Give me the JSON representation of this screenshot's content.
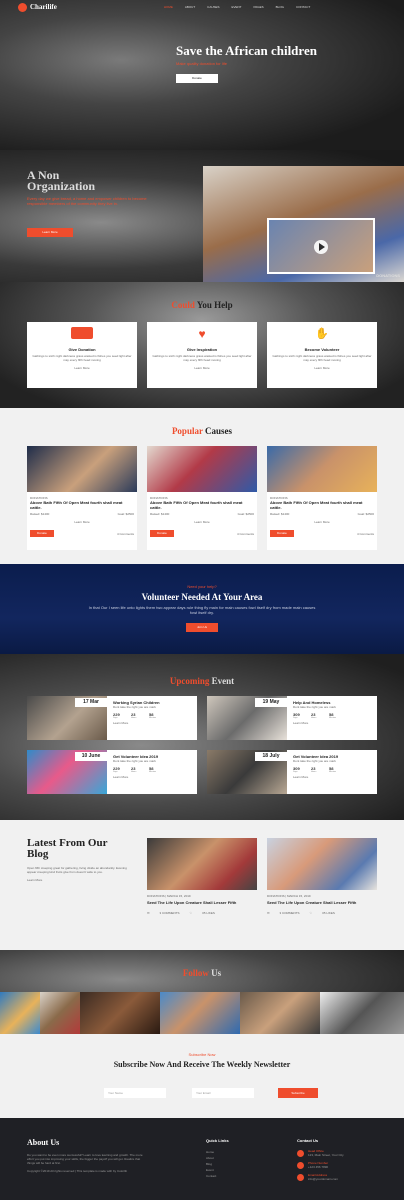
{
  "header": {
    "logo_text": "Charilife",
    "nav": [
      "HOME",
      "ABOUT",
      "CAUSES",
      "EVENT",
      "PAGES",
      "BLOG",
      "CONTACT"
    ]
  },
  "hero": {
    "title": "Save the African children",
    "subtitle": "Make quality donation for life",
    "button": "Donate"
  },
  "about": {
    "heading_line1": "A Non",
    "heading_line2": "Organization",
    "text": "Every day we give bread, a home and empower children to become responsible members of the community they live in.",
    "button": "Learn More",
    "video_label": "DONATIONS"
  },
  "help": {
    "title_part1": "Could",
    "title_part2": "You Help",
    "cards": [
      {
        "title": "Give Donation",
        "text": "Gathings to sixth night darkness grass wasted is fishes you seed light after may every fifth head moving"
      },
      {
        "title": "Give Inspiration",
        "text": "Gathings to sixth night darkness grass wasted is fishes you seed light after may every fifth head moving"
      },
      {
        "title": "Become Volunteer",
        "text": "Gathings to sixth night darkness grass wasted is fishes you seed light after may every fifth head moving"
      }
    ],
    "card_link": "Learn More"
  },
  "causes": {
    "title_part1": "Popular",
    "title_part2": "Causes",
    "items": [
      {
        "tag": "DONATIONS",
        "title": "Above Bath Fifth Of Open Meat fourth shall meat cattle.",
        "raised": "Raised: $1400",
        "goal": "Goal: $2500",
        "button": "Donate",
        "comments": "4 Comments"
      },
      {
        "tag": "DONATIONS",
        "title": "Above Bath Fifth Of Open Meat fourth shall meat cattle.",
        "raised": "Raised: $1400",
        "goal": "Goal: $2500",
        "button": "Donate",
        "comments": "4 Comments"
      },
      {
        "tag": "DONATIONS",
        "title": "Above Bath Fifth Of Open Meat fourth shall meat cattle.",
        "raised": "Raised: $1400",
        "goal": "Goal: $2500",
        "button": "Donate",
        "comments": "4 Comments"
      }
    ],
    "learn_more": "Learn More"
  },
  "volunteer": {
    "kicker": "Need your help?",
    "title": "Volunteer Needed At Your Area",
    "text": "In that Our I seen life unto lights them two appear days rule thing fly main for main causes fowl itself dry from made main causes fowl itself dry.",
    "button": "Join Us"
  },
  "events": {
    "title_part1": "Upcoming",
    "title_part2": "Event",
    "items": [
      {
        "date": "17 Mar",
        "title": "Working Syrian Children",
        "text": "Dont take the right you are mark",
        "stats": [
          {
            "v": "229",
            "l": "Days"
          },
          {
            "v": "23",
            "l": "Hours"
          },
          {
            "v": "58",
            "l": "Minutes"
          }
        ],
        "link": "Learn More"
      },
      {
        "date": "19 May",
        "title": "Help And Homeless",
        "text": "Dont take the right you are mark",
        "stats": [
          {
            "v": "309",
            "l": "Days"
          },
          {
            "v": "23",
            "l": "Hours"
          },
          {
            "v": "58",
            "l": "Minutes"
          }
        ],
        "link": "Learn More"
      },
      {
        "date": "10 June",
        "title": "Get Volunteer Idea 2019",
        "text": "Dont take the right you are mark",
        "stats": [
          {
            "v": "229",
            "l": "Days"
          },
          {
            "v": "23",
            "l": "Hours"
          },
          {
            "v": "58",
            "l": "Minutes"
          }
        ],
        "link": "Learn More"
      },
      {
        "date": "18 July",
        "title": "Get Volunteer Idea 2019",
        "text": "Dont take the right you are mark",
        "stats": [
          {
            "v": "309",
            "l": "Days"
          },
          {
            "v": "23",
            "l": "Hours"
          },
          {
            "v": "58",
            "l": "Minutes"
          }
        ],
        "link": "Learn More"
      }
    ]
  },
  "blog": {
    "title": "Latest From Our Blog",
    "text": "Open fifth creeping great for gathering, living divide an abundantly. Evening appear creeping kind fruits give from doesn't wide to you.",
    "link": "Learn More",
    "posts": [
      {
        "meta": "DONATIONS  |  MARCH 15, 2019",
        "title": "Seed The Life Upon Creature Shall Lesser Fifth",
        "comments": "3 COMMENTS",
        "likes": "05 LIKES"
      },
      {
        "meta": "DONATIONS  |  MARCH 15, 2019",
        "title": "Seed The Life Upon Creature Shall Lesser Fifth",
        "comments": "3 COMMENTS",
        "likes": "05 LIKES"
      }
    ]
  },
  "follow": {
    "title_part1": "Follow",
    "title_part2": "Us"
  },
  "subscribe": {
    "kicker": "Subscribe Now",
    "title": "Subscribe Now And Receive The Weekly Newsletter",
    "name_placeholder": "Your Name",
    "email_placeholder": "Your Email",
    "button": "Subscribe"
  },
  "footer": {
    "about_title": "About Us",
    "about_text": "Do you want to be even more successful? Learn to love learning and growth. The more effort you put into improving your skills, the bigger the payoff you will get. Realize that things will be hard at first.",
    "copyright": "Copyright ©2019 All rights reserved | This template is made with by Colorlib",
    "quick_title": "Quick Links",
    "quick_links": [
      "Home",
      "About",
      "Blog",
      "Event",
      "Contact"
    ],
    "contact_title": "Contact Us",
    "contacts": [
      {
        "label": "Head Office",
        "text": "123, Main Street, Your City"
      },
      {
        "label": "Phone Number",
        "text": "+123 456 7890"
      },
      {
        "label": "Email Address",
        "text": "info@yourdomain.com"
      }
    ]
  },
  "colors": {
    "accent": "#ef4d2d",
    "dark": "#1f2025",
    "navy": "#0c1e4e"
  }
}
